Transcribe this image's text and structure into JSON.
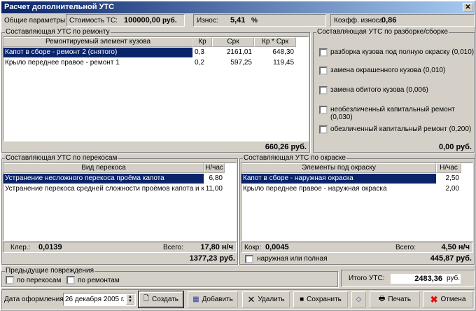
{
  "title": "Расчет дополнительной УТС",
  "params": {
    "label": "Общие параметры:",
    "cost_label": "Стоимость ТС:",
    "cost_value": "100000,00",
    "cost_unit": "руб.",
    "wear_label": "Износ:",
    "wear_value": "5,41",
    "wear_unit": "%",
    "coef_label": "Коэфф. износа:",
    "coef_value": "0,86"
  },
  "repair": {
    "caption": "Составляющая УТС по ремонту",
    "headers": [
      "Ремонтируемый элемент кузова",
      "Кр",
      "Срк",
      "Кр * Срк"
    ],
    "rows": [
      [
        "Капот в сборе - ремонт 2 (снятого)",
        "0,3",
        "2161,01",
        "648,30"
      ],
      [
        "Крыло переднее правое - ремонт 1",
        "0,2",
        "597,25",
        "119,45"
      ]
    ],
    "total": "660,26 руб."
  },
  "assembly": {
    "caption": "Составляющая УТС по разборке/сборке",
    "options": [
      "разборка кузова под полную окраску (0,010)",
      "замена окрашенного кузова (0,010)",
      "замена обитого кузова (0,006)",
      "необезличенный капитальный ремонт (0,030)",
      "обезличенный капитальный ремонт (0,200)"
    ],
    "total": "0,00 руб."
  },
  "skew": {
    "caption": "Составляющая УТС по перекосам",
    "headers": [
      "Вид перекоса",
      "Н/час"
    ],
    "rows": [
      [
        "Устранение несложного перекоса проёма капота",
        "6,80"
      ],
      [
        "Устранение перекоса средней сложности проёмов капота и крыл",
        "11,00"
      ]
    ],
    "k_label": "Клер.:",
    "k_value": "0,0139",
    "sum_label": "Всего:",
    "sum_value": "17,80 н/ч",
    "total": "1377,23 руб."
  },
  "paint": {
    "caption": "Составляющая УТС по окраске",
    "headers": [
      "Элементы под окраску",
      "Н/час"
    ],
    "rows": [
      [
        "Капот в сборе - наружная окраска",
        "2,50"
      ],
      [
        "Крыло переднее правое - наружная окраска",
        "2,00"
      ]
    ],
    "k_label": "Кокр:",
    "k_value": "0,0045",
    "sum_label": "Всего:",
    "sum_value": "4,50 н/ч",
    "check_label": "наружная или полная",
    "total": "445,87 руб."
  },
  "prev": {
    "caption": "Предыдущие повреждения",
    "skew": "по перекосам",
    "repair": "по ремонтам"
  },
  "itog": {
    "label": "Итого УТС:",
    "value": "2483,36",
    "unit": "руб."
  },
  "footer": {
    "date_label": "Дата оформления:",
    "date_value": "26 декабря  2005 г.",
    "create": "Создать",
    "add": "Добавить",
    "delete": "Удалить",
    "save": "Сохранить",
    "print": "Печать",
    "cancel": "Отмена"
  }
}
